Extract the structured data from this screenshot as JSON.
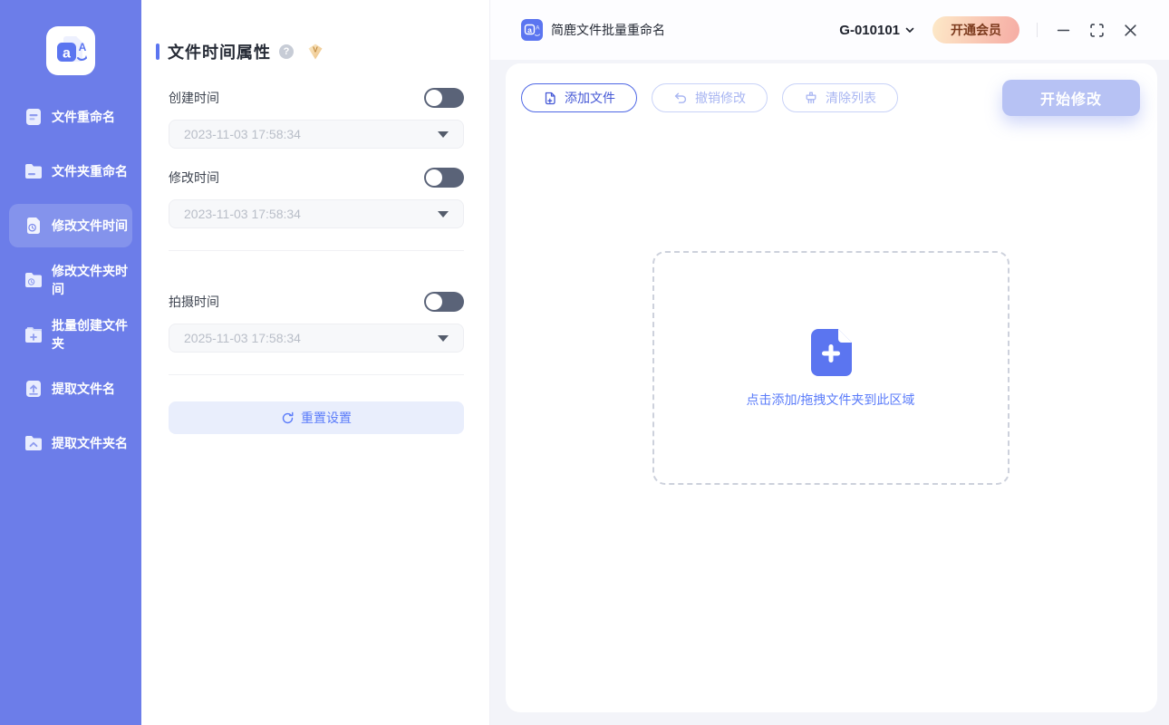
{
  "colors": {
    "sidebar-bg": "#6C7DE9",
    "accent-blue": "#5B75F0",
    "link-blue": "#5B7CFA",
    "toggle-off": "#5A6378",
    "start-btn-bg": "#B7C2F4",
    "disabled-blue": "#A9B6F2",
    "vip-grad-start": "#FDE9C8",
    "vip-grad-end": "#F6ACA4",
    "vip-text": "#7C3A1D"
  },
  "sidebar": {
    "items": [
      {
        "label": "文件重命名",
        "icon": "file-rename-icon",
        "active": false
      },
      {
        "label": "文件夹重命名",
        "icon": "folder-rename-icon",
        "active": false
      },
      {
        "label": "修改文件时间",
        "icon": "file-time-icon",
        "active": true
      },
      {
        "label": "修改文件夹时间",
        "icon": "folder-time-icon",
        "active": false
      },
      {
        "label": "批量创建文件夹",
        "icon": "folder-plus-icon",
        "active": false
      },
      {
        "label": "提取文件名",
        "icon": "file-extract-icon",
        "active": false
      },
      {
        "label": "提取文件夹名",
        "icon": "folder-extract-icon",
        "active": false
      }
    ]
  },
  "settings": {
    "title": "文件时间属性",
    "creation": {
      "label": "创建时间",
      "value": "2023-11-03 17:58:34",
      "enabled": false
    },
    "modified": {
      "label": "修改时间",
      "value": "2023-11-03 17:58:34",
      "enabled": false
    },
    "capture": {
      "label": "拍摄时间",
      "value": "2025-11-03 17:58:34",
      "enabled": false
    },
    "reset_label": "重置设置"
  },
  "titlebar": {
    "app_title": "简鹿文件批量重命名",
    "version": "G-010101",
    "vip_button": "开通会员"
  },
  "toolbar": {
    "add_files_label": "添加文件",
    "undo_label": "撤销修改",
    "clear_label": "清除列表",
    "start_label": "开始修改"
  },
  "dropzone": {
    "hint": "点击添加/拖拽文件夹到此区域"
  }
}
